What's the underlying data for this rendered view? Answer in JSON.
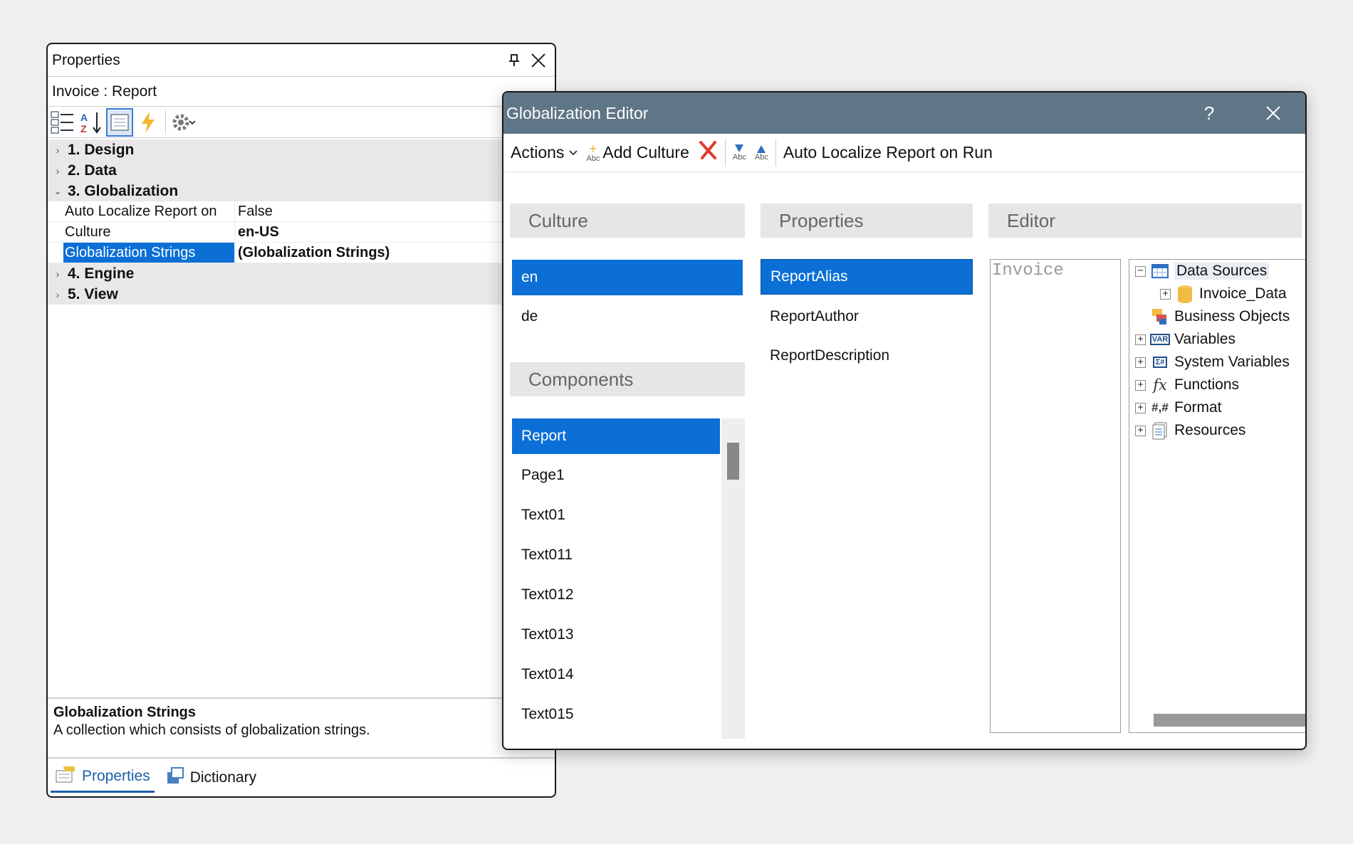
{
  "properties_panel": {
    "title": "Properties",
    "subtitle": "Invoice : Report",
    "toolbar": {
      "icons": [
        "categorized-icon",
        "alphabetical-sort-icon",
        "property-page-icon",
        "events-lightning-icon",
        "settings-gear-icon"
      ]
    },
    "categories": [
      {
        "label": "1. Design",
        "expanded": false
      },
      {
        "label": "2. Data",
        "expanded": false
      },
      {
        "label": "3. Globalization",
        "expanded": true
      },
      {
        "label": "4. Engine",
        "expanded": false
      },
      {
        "label": "5. View",
        "expanded": false
      }
    ],
    "globalization_props": [
      {
        "name": "Auto Localize Report on",
        "value": "False"
      },
      {
        "name": "Culture",
        "value": "en-US"
      },
      {
        "name": "Globalization Strings",
        "value": "(Globalization Strings)"
      }
    ],
    "description": {
      "heading": "Globalization Strings",
      "text": "A collection which consists of globalization strings."
    },
    "bottom_tabs": [
      {
        "label": "Properties",
        "active": true
      },
      {
        "label": "Dictionary",
        "active": false
      }
    ]
  },
  "glob_editor": {
    "title": "Globalization Editor",
    "help": "?",
    "toolbar": {
      "actions_label": "Actions",
      "add_culture_label": "Add Culture",
      "abc": "Abc",
      "auto_localize_label": "Auto Localize Report on Run"
    },
    "culture_header": "Culture",
    "cultures": [
      "en",
      "de"
    ],
    "selected_culture": "en",
    "components_header": "Components",
    "components": [
      "Report",
      "Page1",
      "Text01",
      "Text011",
      "Text012",
      "Text013",
      "Text014",
      "Text015"
    ],
    "selected_component": "Report",
    "properties_header": "Properties",
    "properties": [
      "ReportAlias",
      "ReportAuthor",
      "ReportDescription"
    ],
    "selected_property": "ReportAlias",
    "editor_header": "Editor",
    "editor_value": "Invoice",
    "tree": [
      {
        "label": "Data Sources",
        "expander": "−"
      },
      {
        "label": "Invoice_Data",
        "expander": "+"
      },
      {
        "label": "Business Objects",
        "expander": ""
      },
      {
        "label": "Variables",
        "expander": "+"
      },
      {
        "label": "System Variables",
        "expander": "+"
      },
      {
        "label": "Functions",
        "expander": "+"
      },
      {
        "label": "Format",
        "expander": "+"
      },
      {
        "label": "Resources",
        "expander": "+"
      }
    ],
    "tree_icon_text": {
      "variables": "VAR",
      "system_variables": "Σ#",
      "functions": "fx",
      "format": "#,#"
    }
  }
}
